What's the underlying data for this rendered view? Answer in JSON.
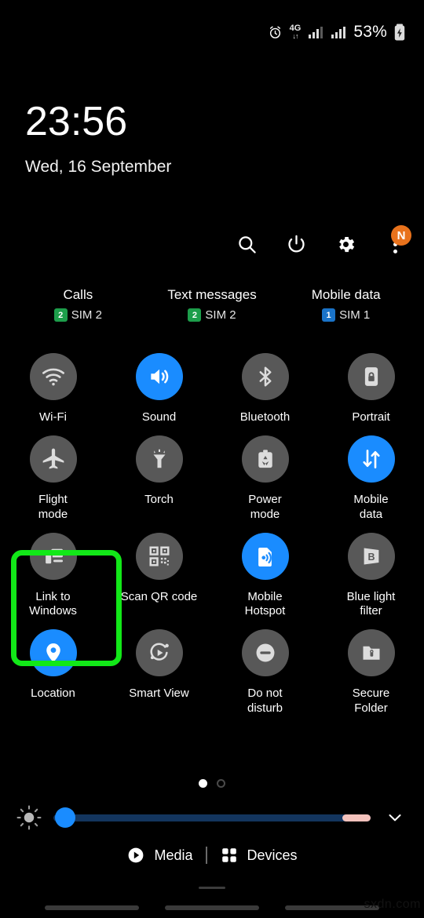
{
  "status_bar": {
    "alarm_icon": "alarm-icon",
    "network_type": "4G",
    "data_arrows": "↓↑",
    "signal_icon_1": "signal-bars-sim1-icon",
    "signal_icon_2": "signal-bars-sim2-icon",
    "battery_percent": "53%",
    "battery_icon": "battery-charging-icon"
  },
  "clock": {
    "time": "23:56",
    "date": "Wed, 16 September"
  },
  "header_actions": [
    {
      "name": "search-icon",
      "label": "Search"
    },
    {
      "name": "power-icon",
      "label": "Power off"
    },
    {
      "name": "gear-icon",
      "label": "Settings"
    },
    {
      "name": "more-options-icon",
      "label": "More options",
      "badge": "N"
    }
  ],
  "sim_row": [
    {
      "title": "Calls",
      "sim": "SIM 2",
      "badge": "2",
      "badge_color": "#1d9e4b"
    },
    {
      "title": "Text messages",
      "sim": "SIM 2",
      "badge": "2",
      "badge_color": "#1d9e4b"
    },
    {
      "title": "Mobile data",
      "sim": "SIM 1",
      "badge": "1",
      "badge_color": "#1a73c8"
    }
  ],
  "tiles": [
    [
      {
        "label": "Wi-Fi",
        "icon": "wifi-icon",
        "active": false
      },
      {
        "label": "Sound",
        "icon": "volume-icon",
        "active": true
      },
      {
        "label": "Bluetooth",
        "icon": "bluetooth-icon",
        "active": false
      },
      {
        "label": "Portrait",
        "icon": "rotation-lock-icon",
        "active": false
      }
    ],
    [
      {
        "label": "Flight\nmode",
        "icon": "airplane-icon",
        "active": false
      },
      {
        "label": "Torch",
        "icon": "flashlight-icon",
        "active": false
      },
      {
        "label": "Power\nmode",
        "icon": "power-mode-icon",
        "active": false
      },
      {
        "label": "Mobile\ndata",
        "icon": "mobile-data-icon",
        "active": true
      }
    ],
    [
      {
        "label": "Link to\nWindows",
        "icon": "link-to-windows-icon",
        "active": false,
        "highlighted": true
      },
      {
        "label": "Scan QR code",
        "icon": "qr-code-icon",
        "active": false
      },
      {
        "label": "Mobile\nHotspot",
        "icon": "hotspot-icon",
        "active": true
      },
      {
        "label": "Blue light\nfilter",
        "icon": "blue-light-filter-icon",
        "active": false
      }
    ],
    [
      {
        "label": "Location",
        "icon": "location-pin-icon",
        "active": true
      },
      {
        "label": "Smart View",
        "icon": "smart-view-icon",
        "active": false
      },
      {
        "label": "Do not\ndisturb",
        "icon": "do-not-disturb-icon",
        "active": false
      },
      {
        "label": "Secure\nFolder",
        "icon": "secure-folder-icon",
        "active": false
      }
    ]
  ],
  "pager": {
    "total": 2,
    "active_index": 0
  },
  "brightness": {
    "icon": "brightness-sun-icon",
    "value_percent": 3,
    "expand_icon": "chevron-down-icon"
  },
  "bottom_bar": {
    "media_label": "Media",
    "media_icon": "play-circle-icon",
    "devices_label": "Devices",
    "devices_icon": "devices-grid-icon"
  },
  "watermark": "sxdn.com",
  "colors": {
    "accent_blue": "#1a8cff",
    "tile_off": "#585858",
    "highlight_green": "#12e818",
    "badge_orange": "#e8721c"
  }
}
